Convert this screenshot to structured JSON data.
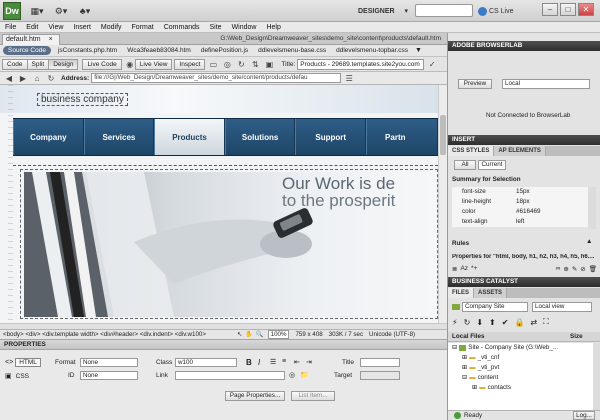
{
  "app": {
    "logo": "Dw",
    "workspace": "DESIGNER",
    "cs_live": "CS Live"
  },
  "menu": [
    "File",
    "Edit",
    "View",
    "Insert",
    "Modify",
    "Format",
    "Commands",
    "Site",
    "Window",
    "Help"
  ],
  "document": {
    "tab": "default.htm",
    "path": "G:\\Web_Design\\Dreamweaver_sites\\demo_site\\content\\products\\default.htm",
    "related_files": [
      "Source Code",
      "jsConstants.php.htm",
      "Wca3feaeb83084.htm",
      "definePosition.js",
      "ddlevelsmenu-base.css",
      "ddlevelsmenu-topbar.css"
    ],
    "views": [
      "Code",
      "Split",
      "Design"
    ],
    "live_buttons": [
      "Live Code",
      "Live View",
      "Inspect"
    ],
    "title_label": "Title:",
    "title_value": "Products - 29689.templates.site2you.com",
    "address_label": "Address:",
    "address_value": "file:///G|/Web_Design/Dreamweaver_sites/demo_site/content/products/defau",
    "tagline": "business company",
    "nav_items": [
      "Company",
      "Services",
      "Products",
      "Solutions",
      "Support",
      "Partn"
    ],
    "active_nav": "Products",
    "hero_line1": "Our Work is de",
    "hero_line2": "to the prosperit",
    "status": {
      "tags": "<body> <div> <div.template width> <div#header> <div.indent> <div.w100>",
      "zoom": "100%",
      "size": "759 x 408",
      "weight": "303K / 7 sec",
      "encoding": "Unicode (UTF-8)"
    }
  },
  "properties": {
    "header": "PROPERTIES",
    "html": "HTML",
    "css": "CSS",
    "format_label": "Format",
    "format_value": "None",
    "id_label": "ID",
    "id_value": "None",
    "class_label": "Class",
    "class_value": "w100",
    "link_label": "Link",
    "title_label": "Title",
    "target_label": "Target",
    "bold": "B",
    "italic": "I",
    "page_properties": "Page Properties...",
    "list_item": "List Item..."
  },
  "right": {
    "browserlab": {
      "header": "ADOBE BROWSERLAB",
      "preview": "Preview",
      "local": "Local",
      "status": "Not Connected to BrowserLab"
    },
    "insert_header": "INSERT",
    "css": {
      "tabs": [
        "CSS STYLES",
        "AP ELEMENTS"
      ],
      "all": "All",
      "current": "Current",
      "summary_title": "Summary for Selection",
      "rows": [
        {
          "prop": "font-size",
          "val": "15px"
        },
        {
          "prop": "line-height",
          "val": "18px"
        },
        {
          "prop": "color",
          "val": "#616469"
        },
        {
          "prop": "text-align",
          "val": "left"
        }
      ],
      "rules": "Rules",
      "props_for": "Properties for \"html, body, h1, h2, h3, h4, h5, h6...."
    },
    "business_catalyst": "BUSINESS CATALYST",
    "files": {
      "tabs": [
        "FILES",
        "ASSETS"
      ],
      "site": "Company Site",
      "view": "Local view",
      "local_files": "Local Files",
      "size_col": "Size",
      "tree": [
        {
          "name": "Site - Company Site (G:\\Web_...",
          "indent": 0
        },
        {
          "name": "_vti_cnf",
          "indent": 1
        },
        {
          "name": "_vti_pvt",
          "indent": 1
        },
        {
          "name": "content",
          "indent": 1
        },
        {
          "name": "contacts",
          "indent": 2
        }
      ],
      "ready": "Ready",
      "log": "Log..."
    }
  }
}
